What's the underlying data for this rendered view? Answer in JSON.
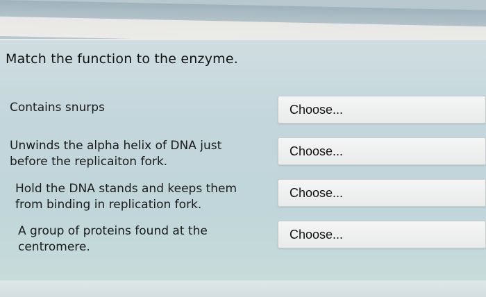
{
  "question": "Match the function to the enzyme.",
  "rows": [
    {
      "label": "Contains snurps",
      "choice": "Choose..."
    },
    {
      "label": "Unwinds the alpha helix of DNA just before the replicaiton fork.",
      "choice": "Choose..."
    },
    {
      "label": "Hold the DNA stands and keeps them from binding in replication fork.",
      "choice": "Choose..."
    },
    {
      "label": "A group of proteins found at the centromere.",
      "choice": "Choose..."
    }
  ]
}
